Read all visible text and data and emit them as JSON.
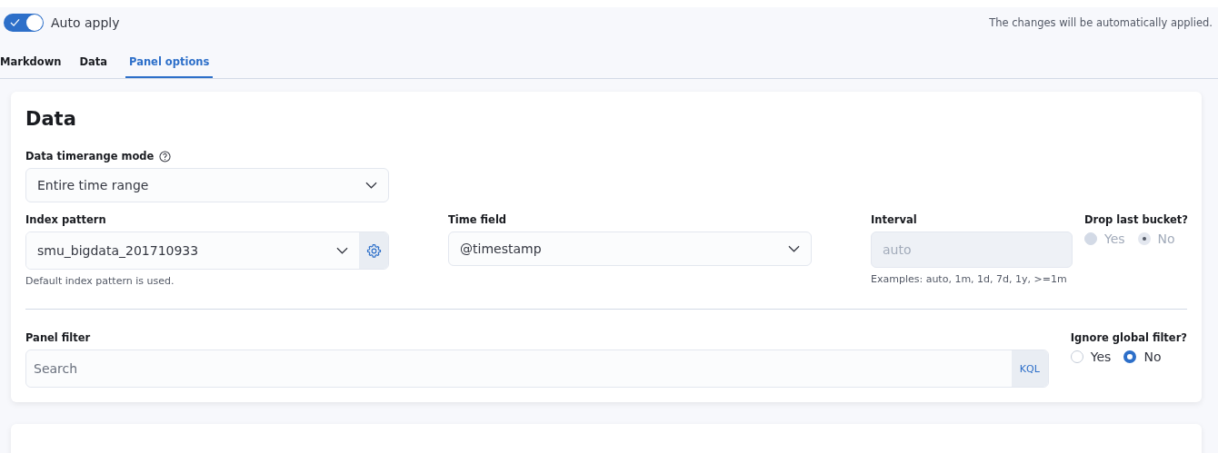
{
  "auto_apply": {
    "label": "Auto apply",
    "on": true
  },
  "notice": "The changes will be automatically applied.",
  "tabs": [
    {
      "label": "Markdown",
      "selected": false
    },
    {
      "label": "Data",
      "selected": false
    },
    {
      "label": "Panel options",
      "selected": true
    }
  ],
  "data_section": {
    "title": "Data",
    "timerange_mode": {
      "label": "Data timerange mode",
      "value": "Entire time range"
    },
    "index_pattern": {
      "label": "Index pattern",
      "value": "smu_bigdata_201710933",
      "help": "Default index pattern is used."
    },
    "time_field": {
      "label": "Time field",
      "value": "@timestamp"
    },
    "interval": {
      "label": "Interval",
      "placeholder": "auto",
      "disabled": true,
      "help": "Examples: auto, 1m, 1d, 7d, 1y, >=1m"
    },
    "drop_last_bucket": {
      "label": "Drop last bucket?",
      "disabled": true,
      "options": [
        {
          "label": "Yes",
          "selected": false
        },
        {
          "label": "No",
          "selected": true
        }
      ]
    },
    "panel_filter": {
      "label": "Panel filter",
      "placeholder": "Search",
      "language": "KQL"
    },
    "ignore_global_filter": {
      "label": "Ignore global filter?",
      "disabled": false,
      "options": [
        {
          "label": "Yes",
          "selected": false
        },
        {
          "label": "No",
          "selected": true
        }
      ]
    }
  }
}
